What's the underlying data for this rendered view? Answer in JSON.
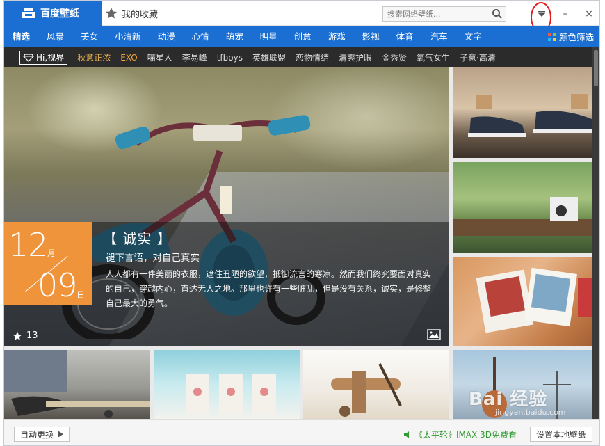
{
  "titlebar": {
    "app_tab": "百度壁纸",
    "fav_tab": "我的收藏",
    "search_placeholder": "搜索网络壁纸...",
    "min_symbol": "–",
    "close_symbol": "×"
  },
  "categories": {
    "items": [
      "精选",
      "风景",
      "美女",
      "小清新",
      "动漫",
      "心情",
      "萌宠",
      "明星",
      "创意",
      "游戏",
      "影视",
      "体育",
      "汽车",
      "文字"
    ],
    "active": "精选",
    "filter_label": "颜色筛选"
  },
  "tags": {
    "badge": "Hi,视界",
    "items": [
      "秋意正浓",
      "EXO",
      "喵星人",
      "李易峰",
      "tfboys",
      "英雄联盟",
      "恋物情结",
      "清爽护眼",
      "金秀贤",
      "氧气女生",
      "子意·高清"
    ],
    "hot_index": 0,
    "orange_index": 1
  },
  "hero": {
    "month": "12",
    "month_unit": "月",
    "day": "09",
    "day_unit": "日",
    "title": "【 诚实 】",
    "subtitle": "褪下言语，对自己真实",
    "description": "人人都有一件美丽的衣服，遮住丑陋的欲望，抵御流言的寒凉。然而我们终究要面对真实的自己，穿越内心，直达无人之地。那里也许有一些脏乱，但是没有关系，诚实，是修整自己最大的勇气。",
    "likes": "13"
  },
  "watermark": {
    "brand": "Bai  经验",
    "url": "jingyan.baidu.com"
  },
  "footer": {
    "auto_change": "自动更换",
    "promo": "《太平轮》IMAX 3D免费看",
    "set_local": "设置本地壁纸"
  },
  "colors": {
    "primary": "#1b6fd3",
    "tag_bar": "#2b2b2b",
    "date_orange": "#f0943c",
    "promo_green": "#339933",
    "annotation_red": "#e31b1b"
  }
}
